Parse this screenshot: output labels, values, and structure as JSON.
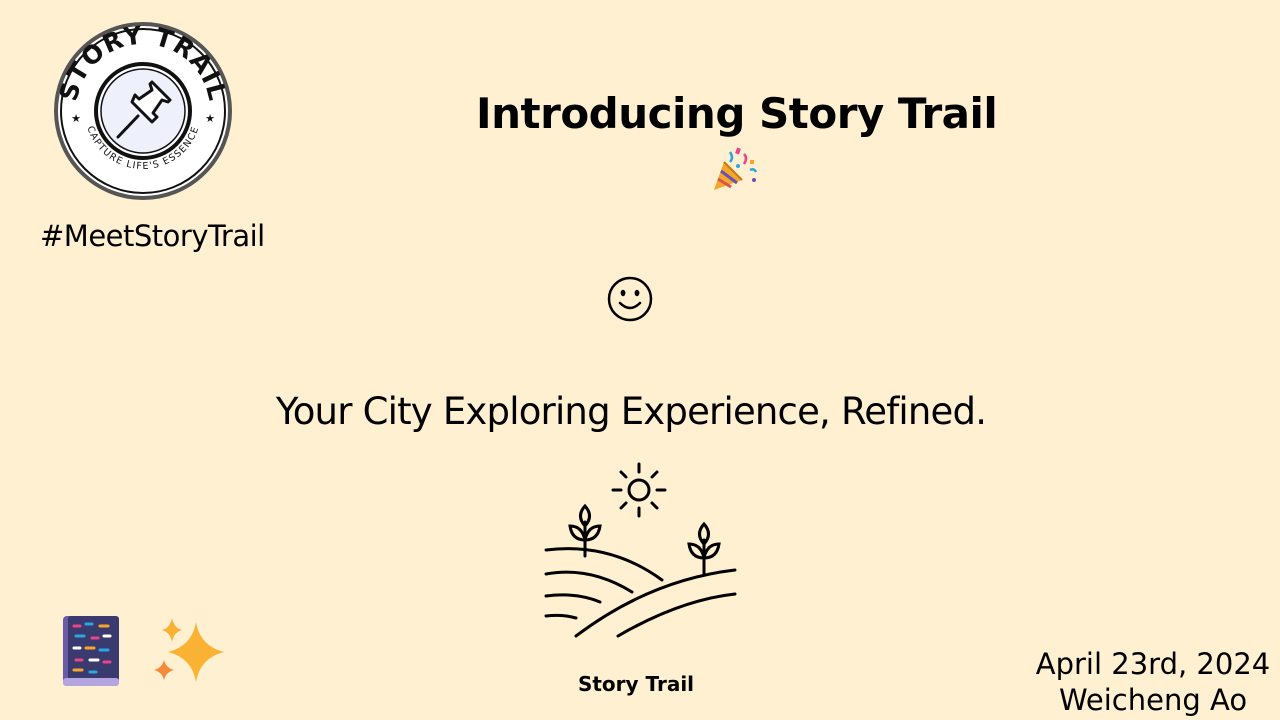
{
  "logo": {
    "name": "STORY TRAIL",
    "tagline": "CAPTURE LIFE'S ESSENCE",
    "icon": "pushpin-icon"
  },
  "hashtag": "#MeetStoryTrail",
  "title": "Introducing Story Trail",
  "icons": {
    "title_emoji": "party-popper-icon",
    "center_emoji": "smiley-icon",
    "illustration": "sun-and-fields-icon",
    "bottom_left_1": "book-icon",
    "bottom_left_2": "sparkles-icon"
  },
  "tagline": "Your City Exploring Experience, Refined.",
  "footer_brand": "Story Trail",
  "date": "April 23rd, 2024",
  "author": "Weicheng Ao",
  "colors": {
    "background": "#fef0d0",
    "text": "#000000"
  }
}
